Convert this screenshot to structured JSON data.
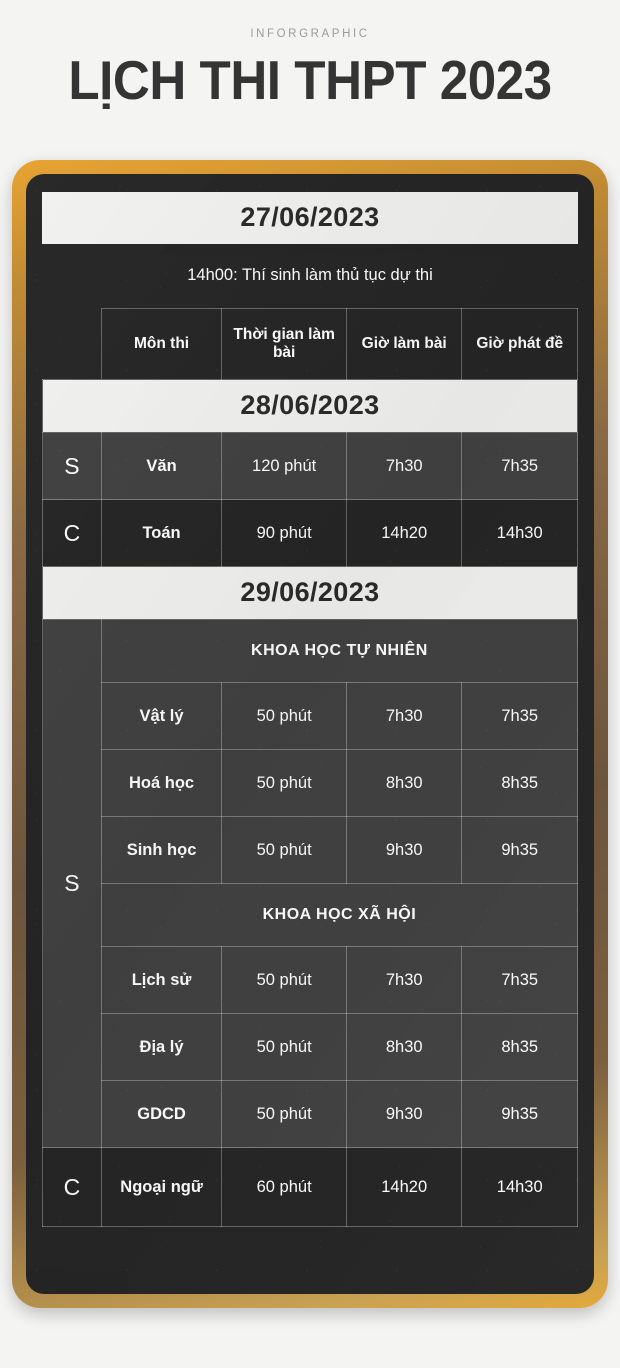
{
  "header": {
    "kicker": "INFORGRAPHIC",
    "title_light": "LỊCH THI ",
    "title_bold": "THPT 2023",
    "title_full": "LỊCH THI THPT 2023"
  },
  "table": {
    "columns": {
      "session": "",
      "subject": "Môn thi",
      "duration": "Thời gian làm bài",
      "start_time": "Giờ làm bài",
      "paper_time": "Giờ phát đề"
    }
  },
  "days": [
    {
      "date": "27/06/2023",
      "note": "14h00: Thí sinh làm thủ tục dự thi"
    },
    {
      "date": "28/06/2023",
      "rows": [
        {
          "session": "S",
          "subject": "Văn",
          "duration": "120 phút",
          "start_time": "7h30",
          "paper_time": "7h35"
        },
        {
          "session": "C",
          "subject": "Toán",
          "duration": "90 phút",
          "start_time": "14h20",
          "paper_time": "14h30"
        }
      ]
    },
    {
      "date": "29/06/2023",
      "morning_session": "S",
      "afternoon_session": "C",
      "groups": [
        {
          "name": "KHOA HỌC TỰ NHIÊN",
          "rows": [
            {
              "subject": "Vật lý",
              "duration": "50 phút",
              "start_time": "7h30",
              "paper_time": "7h35"
            },
            {
              "subject": "Hoá học",
              "duration": "50 phút",
              "start_time": "8h30",
              "paper_time": "8h35"
            },
            {
              "subject": "Sinh học",
              "duration": "50 phút",
              "start_time": "9h30",
              "paper_time": "9h35"
            }
          ]
        },
        {
          "name": "KHOA HỌC XÃ HỘI",
          "rows": [
            {
              "subject": "Lịch sử",
              "duration": "50 phút",
              "start_time": "7h30",
              "paper_time": "7h35"
            },
            {
              "subject": "Địa lý",
              "duration": "50 phút",
              "start_time": "8h30",
              "paper_time": "8h35"
            },
            {
              "subject": "GDCD",
              "duration": "50 phút",
              "start_time": "9h30",
              "paper_time": "9h35"
            }
          ]
        }
      ],
      "afternoon_row": {
        "subject": "Ngoại ngữ",
        "duration": "60 phút",
        "start_time": "14h20",
        "paper_time": "14h30"
      }
    }
  ],
  "colors": {
    "page_background": "#f4f4f3",
    "board_background": "#262626",
    "frame_gold": "#e8a433",
    "frame_brown": "#6d553c",
    "banner_background": "#f2f2f0",
    "banner_text": "#2b2b2b",
    "text_light": "#ffffff"
  }
}
